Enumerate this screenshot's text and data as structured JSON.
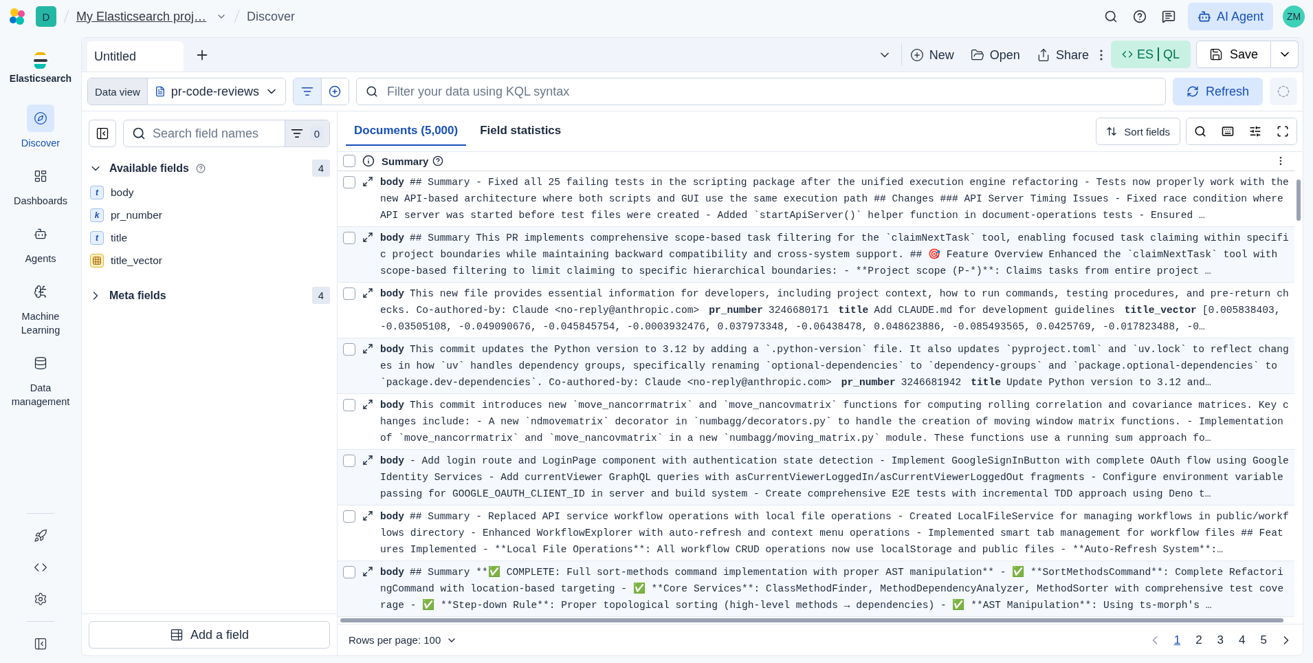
{
  "header": {
    "space": "D",
    "breadcrumbs": [
      "My Elasticsearch proj…",
      "Discover"
    ],
    "ai_agent": "AI Agent",
    "avatar": "ZM"
  },
  "nav": {
    "title": "Elasticsearch",
    "items": [
      {
        "label": "Discover",
        "kind": "discover",
        "selected": true
      },
      {
        "label": "Dashboards",
        "kind": "dashboards",
        "selected": false
      },
      {
        "label": "Agents",
        "kind": "agents",
        "selected": false
      },
      {
        "label": "Machine Learning",
        "kind": "ml",
        "selected": false
      },
      {
        "label": "Data management",
        "kind": "data",
        "selected": false
      }
    ]
  },
  "tabs": [
    {
      "label": "Untitled",
      "selected": true
    }
  ],
  "toolbar": {
    "actions": [
      {
        "label": "New",
        "kind": "new"
      },
      {
        "label": "Open",
        "kind": "open"
      },
      {
        "label": "Share",
        "kind": "share"
      }
    ],
    "esql": [
      "ES",
      "QL"
    ],
    "save": "Save"
  },
  "query": {
    "data_view_label": "Data view",
    "data_view": "pr-code-reviews",
    "placeholder": "Filter your data using KQL syntax",
    "refresh": "Refresh"
  },
  "fields": {
    "search_placeholder": "Search field names",
    "filter_count": "0",
    "groups": [
      {
        "label": "Available fields",
        "expanded": true,
        "count": "4",
        "help": true,
        "fields": [
          {
            "name": "body",
            "kind": "text",
            "badge": "t"
          },
          {
            "name": "pr_number",
            "kind": "text",
            "badge": "k"
          },
          {
            "name": "title",
            "kind": "text",
            "badge": "t"
          },
          {
            "name": "title_vector",
            "kind": "vector"
          }
        ]
      },
      {
        "label": "Meta fields",
        "expanded": false,
        "count": "4"
      }
    ],
    "add_field": "Add a field"
  },
  "documents": {
    "tabs": [
      {
        "label": "Documents (5,000)",
        "selected": true
      },
      {
        "label": "Field statistics",
        "selected": false
      }
    ],
    "sort_fields": "Sort fields",
    "column": "Summary",
    "all_checked": false,
    "rows": [
      {
        "checked": false,
        "segments": [
          {
            "field": "body",
            "value": "## Summary - Fixed all 25 failing tests in the scripting package after the unified execution engine refactoring - Tests now properly work with the new API-based architecture where both scripts and GUI use the same execution path ## Changes ### API Server Timing Issues - Fixed race condition where API server was started before test files were created - Added `startApiServer()` helper function in document-operations tests - Ensured …"
          }
        ]
      },
      {
        "checked": false,
        "segments": [
          {
            "field": "body",
            "value": "## Summary This PR implements comprehensive scope-based task filtering for the `claimNextTask` tool, enabling focused task claiming within specific project boundaries while maintaining backward compatibility and cross-system support. ## 🎯 Feature Overview Enhanced the `claimNextTask` tool with scope-based filtering to limit claiming to specific hierarchical boundaries: - **Project scope (P-*)**: Claims tasks from entire project …"
          }
        ]
      },
      {
        "checked": false,
        "segments": [
          {
            "field": "body",
            "value": "This new file provides essential information for developers, including project context, how to run commands, testing procedures, and pre-return checks. Co-authored-by: Claude <no-reply@anthropic.com>"
          },
          {
            "field": "pr_number",
            "value": "3246680171"
          },
          {
            "field": "title",
            "value": "Add CLAUDE.md for development guidelines"
          },
          {
            "field": "title_vector",
            "value": "[0.005838403, -0.03505108, -0.049090676, -0.045845754, -0.0003932476, 0.037973348, -0.06438478, 0.048623886, -0.085493565, 0.0425769, -0.017823488, -0…"
          }
        ]
      },
      {
        "checked": false,
        "segments": [
          {
            "field": "body",
            "value": "This commit updates the Python version to 3.12 by adding a `.python-version` file. It also updates `pyproject.toml` and `uv.lock` to reflect changes in how `uv` handles dependency groups, specifically renaming `optional-dependencies` to `dependency-groups` and `package.optional-dependencies` to `package.dev-dependencies`. Co-authored-by: Claude <no-reply@anthropic.com>"
          },
          {
            "field": "pr_number",
            "value": "3246681942"
          },
          {
            "field": "title",
            "value": "Update Python version to 3.12 and…"
          }
        ]
      },
      {
        "checked": false,
        "segments": [
          {
            "field": "body",
            "value": "This commit introduces new `move_nancorrmatrix` and `move_nancovmatrix` functions for computing rolling correlation and covariance matrices. Key changes include: - A new `ndmovematrix` decorator in `numbagg/decorators.py` to handle the creation of moving window matrix functions. - Implementation of `move_nancorrmatrix` and `move_nancovmatrix` in a new `numbagg/moving_matrix.py` module. These functions use a running sum approach fo…"
          }
        ]
      },
      {
        "checked": false,
        "segments": [
          {
            "field": "body",
            "value": "- Add login route and LoginPage component with authentication state detection - Implement GoogleSignInButton with complete OAuth flow using Google Identity Services - Add currentViewer GraphQL queries with asCurrentViewerLoggedIn/asCurrentViewerLoggedOut fragments - Configure environment variable passing for GOOGLE_OAUTH_CLIENT_ID in server and build system - Create comprehensive E2E tests with incremental TDD approach using Deno t…"
          }
        ]
      },
      {
        "checked": false,
        "segments": [
          {
            "field": "body",
            "value": "## Summary - Replaced API service workflow operations with local file operations - Created LocalFileService for managing workflows in public/workflows directory - Enhanced WorkflowExplorer with auto-refresh and context menu operations - Implemented smart tab management for workflow files ## Features Implemented - **Local File Operations**: All workflow CRUD operations now use localStorage and public files - **Auto-Refresh System**:…"
          }
        ]
      },
      {
        "checked": false,
        "segments": [
          {
            "field": "body",
            "value": "## Summary **✅ COMPLETE: Full sort-methods command implementation with proper AST manipulation** - ✅ **SortMethodsCommand**: Complete RefactoringCommand with location-based targeting - ✅ **Core Services**: ClassMethodFinder, MethodDependencyAnalyzer, MethodSorter with comprehensive test coverage - ✅ **Step-down Rule**: Proper topological sorting (high-level methods → dependencies) - ✅ **AST Manipulation**: Using ts-morph's …"
          }
        ]
      }
    ],
    "rows_per_page": "Rows per page: 100",
    "pages": [
      {
        "label": "1",
        "selected": true
      },
      {
        "label": "2",
        "selected": false
      },
      {
        "label": "3",
        "selected": false
      },
      {
        "label": "4",
        "selected": false
      },
      {
        "label": "5",
        "selected": false
      }
    ]
  }
}
